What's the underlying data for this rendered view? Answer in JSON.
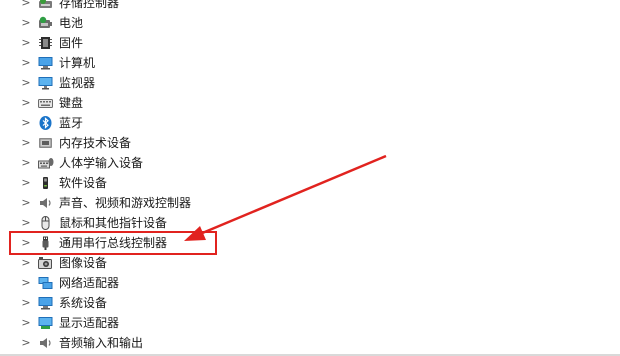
{
  "device_tree": {
    "items": [
      {
        "label": "存储控制器",
        "icon": "storage-controller-icon"
      },
      {
        "label": "电池",
        "icon": "battery-icon"
      },
      {
        "label": "固件",
        "icon": "firmware-icon"
      },
      {
        "label": "计算机",
        "icon": "computer-icon"
      },
      {
        "label": "监视器",
        "icon": "monitor-icon"
      },
      {
        "label": "键盘",
        "icon": "keyboard-icon"
      },
      {
        "label": "蓝牙",
        "icon": "bluetooth-icon"
      },
      {
        "label": "内存技术设备",
        "icon": "memory-device-icon"
      },
      {
        "label": "人体学输入设备",
        "icon": "hid-icon"
      },
      {
        "label": "软件设备",
        "icon": "software-device-icon"
      },
      {
        "label": "声音、视频和游戏控制器",
        "icon": "sound-controller-icon"
      },
      {
        "label": "鼠标和其他指针设备",
        "icon": "mouse-icon"
      },
      {
        "label": "通用串行总线控制器",
        "icon": "usb-icon"
      },
      {
        "label": "图像设备",
        "icon": "camera-icon"
      },
      {
        "label": "网络适配器",
        "icon": "network-adapter-icon"
      },
      {
        "label": "系统设备",
        "icon": "system-device-icon"
      },
      {
        "label": "显示适配器",
        "icon": "display-adapter-icon"
      },
      {
        "label": "音频输入和输出",
        "icon": "audio-io-icon"
      }
    ]
  },
  "annotation": {
    "highlight_color": "#e1231f",
    "highlighted_item": "通用串行总线控制器"
  }
}
